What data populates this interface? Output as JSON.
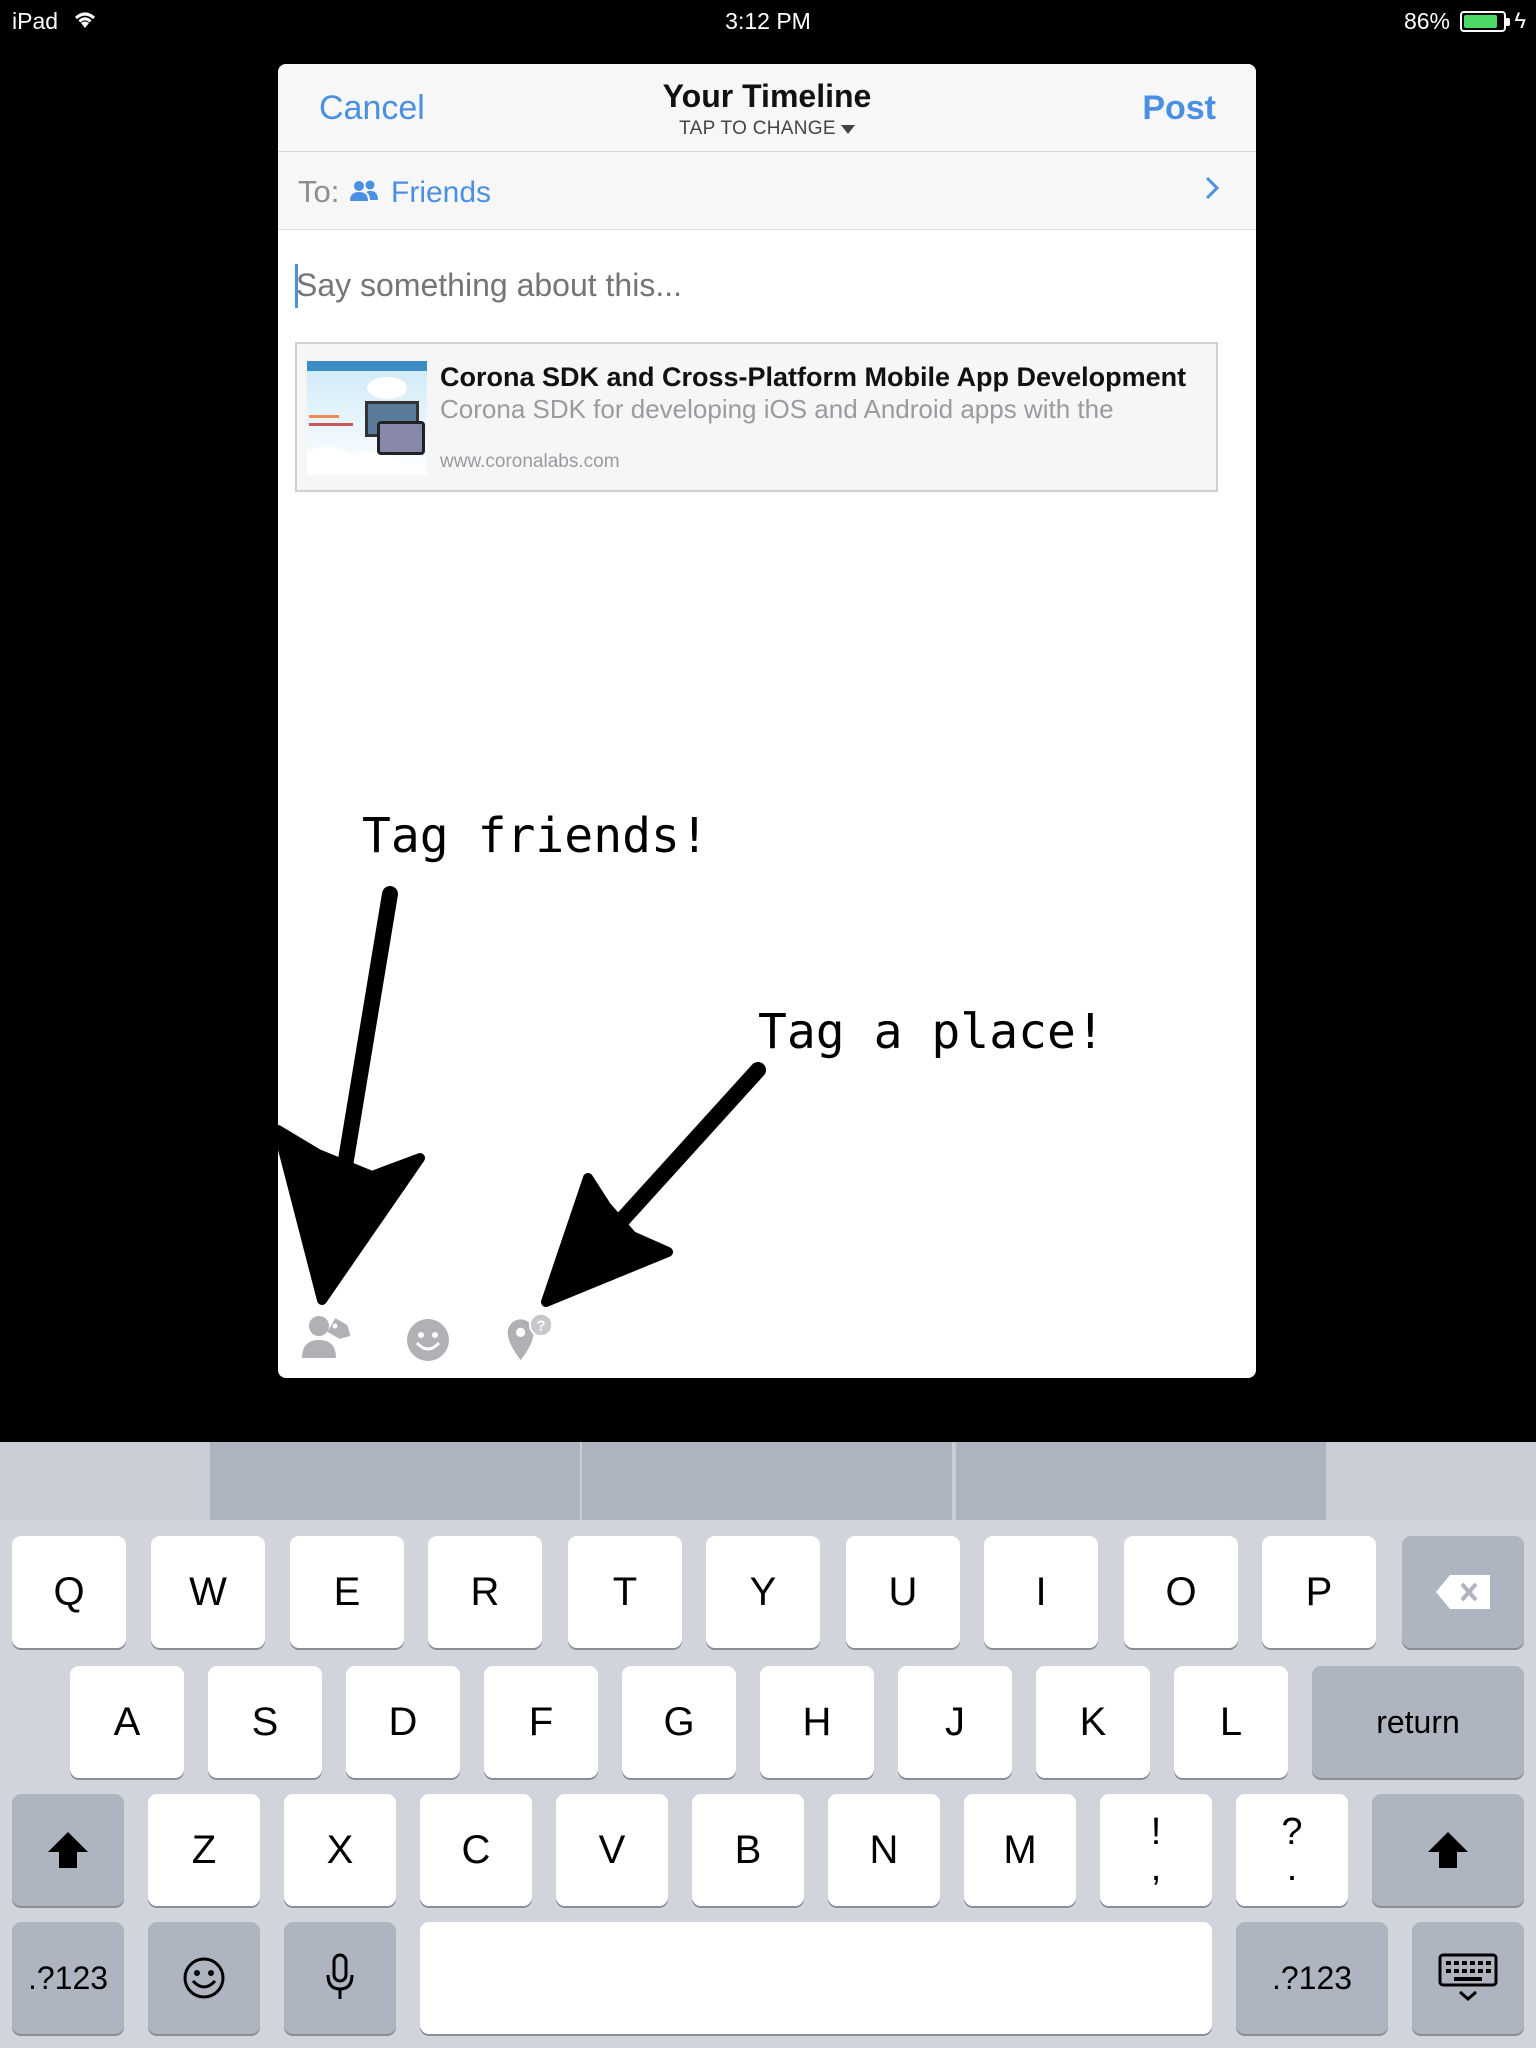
{
  "status_bar": {
    "device": "iPad",
    "time": "3:12 PM",
    "battery": "86%",
    "battery_level": 0.86
  },
  "composer": {
    "cancel_label": "Cancel",
    "title": "Your Timeline",
    "subtitle": "TAP TO CHANGE",
    "post_label": "Post",
    "to_label": "To:",
    "audience": "Friends",
    "placeholder": "Say something about this...",
    "link": {
      "title": "Corona SDK and Cross-Platform Mobile App Development",
      "description": "Corona SDK for developing iOS and Android apps with the",
      "domain": "www.coronalabs.com"
    },
    "toolbar": [
      "tag-friends-icon",
      "emoji-icon",
      "place-icon"
    ]
  },
  "annotations": {
    "tag_friends": "Tag friends!",
    "tag_place": "Tag a place!"
  },
  "keyboard": {
    "row1": [
      "Q",
      "W",
      "E",
      "R",
      "T",
      "Y",
      "U",
      "I",
      "O",
      "P"
    ],
    "row2": [
      "A",
      "S",
      "D",
      "F",
      "G",
      "H",
      "J",
      "K",
      "L"
    ],
    "row3": [
      "Z",
      "X",
      "C",
      "V",
      "B",
      "N",
      "M"
    ],
    "return_label": "return",
    "numbers_label": ".?123",
    "punct1": [
      "!",
      ","
    ],
    "punct2": [
      "?",
      "."
    ]
  },
  "colors": {
    "accent": "#4a90e2",
    "keyboard_bg": "#d1d5db",
    "battery": "#4cd964"
  }
}
